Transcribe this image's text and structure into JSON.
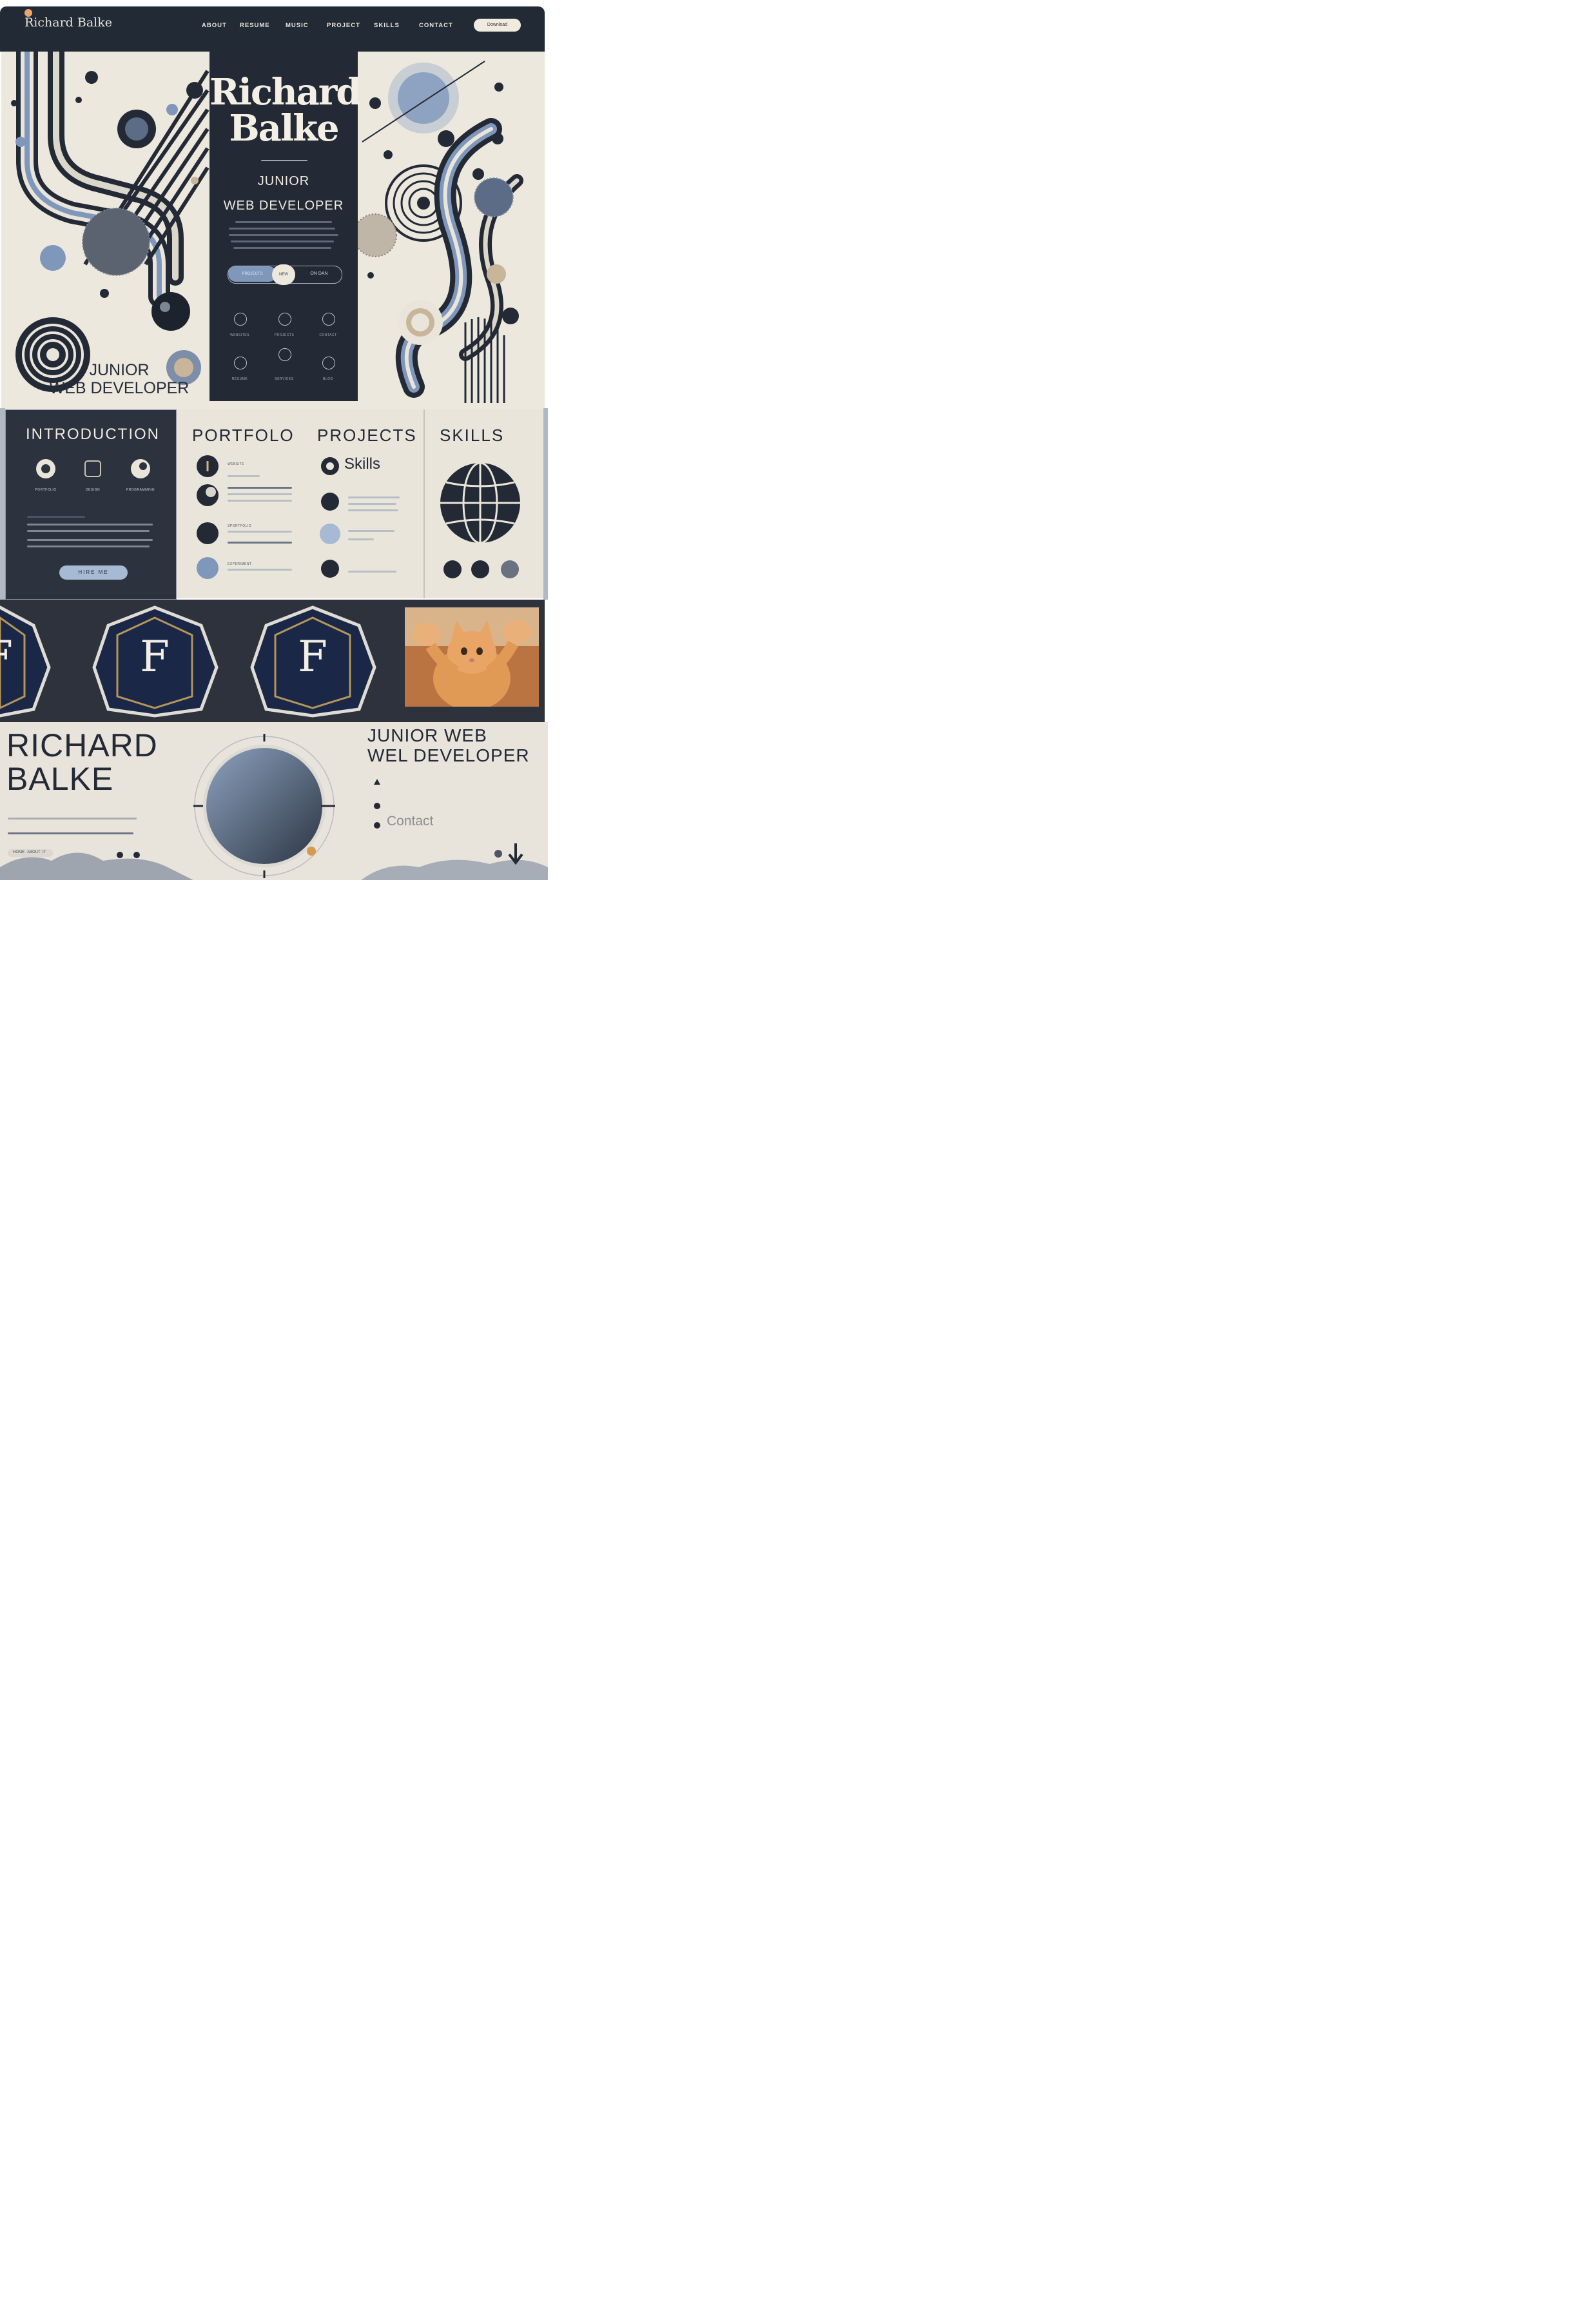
{
  "nav": {
    "logo": "Richard Balke",
    "items": [
      "ABOUT",
      "RESUME",
      "MUSIC",
      "PROJECT",
      "SKILLS",
      "CONTACT"
    ],
    "button_label": "Download"
  },
  "hero": {
    "title_line1": "Richard",
    "title_line2": "Balke",
    "role_line1": "JUNIOR",
    "role_line2": "WEB DEVELOPER",
    "pill_a": "PROJECTS",
    "pill_b": "NEW",
    "pill_c": "ON DAN",
    "icon_labels": [
      "WEBSITES",
      "PROJECTS",
      "CONTACT",
      "RESUME",
      "SERVICES",
      "BLOG"
    ],
    "caption_line1": "JUNIOR",
    "caption_line2": "WEB DEVELOPER"
  },
  "sections": {
    "introduction": "INTRODUCTION",
    "portfolio": "PORTFOLO",
    "projects": "PROJECTS",
    "skills": "SKILLS",
    "skills_sub": "Skills",
    "intro_icon_labels": [
      "PORTFOLIO",
      "DESIGN",
      "PROGRAMMING"
    ],
    "intro_button": "HIRE ME",
    "portfolio_labels": [
      "WEBSITE",
      "",
      "SPORTFOLIO",
      "EXPERIMENT"
    ]
  },
  "badges": {
    "letter": "F"
  },
  "footer_hero": {
    "name_line1": "RICHARD",
    "name_line2": "BALKE",
    "role_line1": "JUNIOR WEB",
    "role_line2": "WEL DEVELOPER",
    "contact": "Contact",
    "mini_nav": [
      "HOME",
      "ABOUT",
      "IT"
    ]
  },
  "colors": {
    "navy": "#222a35",
    "cream": "#ece8de",
    "steel_blue": "#7f97bb",
    "gold": "#b5965a",
    "badge_blue": "#1a2747"
  }
}
